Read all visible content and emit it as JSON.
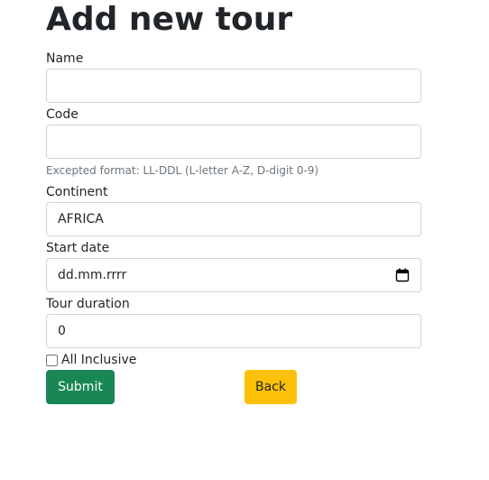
{
  "page": {
    "title": "Add new tour"
  },
  "form": {
    "name": {
      "label": "Name",
      "value": ""
    },
    "code": {
      "label": "Code",
      "value": "",
      "help": "Excepted format: LL-DDL (L-letter A-Z, D-digit 0-9)"
    },
    "continent": {
      "label": "Continent",
      "value": "AFRICA"
    },
    "start_date": {
      "label": "Start date",
      "value": "dd.mm.rrrr",
      "icon": "calendar-icon"
    },
    "duration": {
      "label": "Tour duration",
      "value": "0"
    },
    "all_inclusive": {
      "label": "All Inclusive",
      "checked": false
    }
  },
  "buttons": {
    "submit": {
      "label": "Submit",
      "color": "#198754"
    },
    "back": {
      "label": "Back",
      "color": "#ffc107"
    }
  }
}
